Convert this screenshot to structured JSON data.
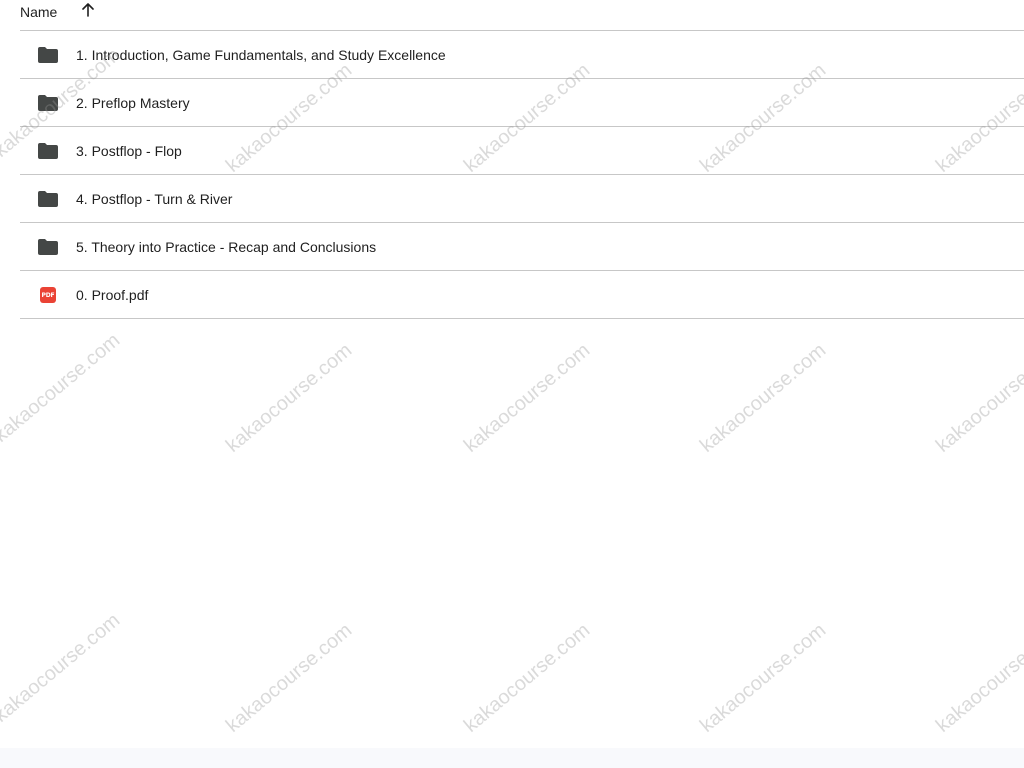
{
  "header": {
    "name_label": "Name",
    "sort_icon": "arrow-up-icon"
  },
  "files": [
    {
      "name": "1. Introduction, Game Fundamentals, and Study Excellence",
      "type": "folder",
      "icon": "folder-icon"
    },
    {
      "name": "2. Preflop Mastery",
      "type": "folder",
      "icon": "folder-icon"
    },
    {
      "name": "3. Postflop - Flop",
      "type": "folder",
      "icon": "folder-icon"
    },
    {
      "name": "4. Postflop - Turn & River",
      "type": "folder",
      "icon": "folder-icon"
    },
    {
      "name": "5. Theory into Practice - Recap and Conclusions",
      "type": "folder",
      "icon": "folder-icon"
    },
    {
      "name": "0. Proof.pdf",
      "type": "pdf",
      "icon": "pdf-icon",
      "badge": "PDF"
    }
  ],
  "watermark": "kakaocourse.com",
  "colors": {
    "folder": "#444746",
    "pdf": "#ea4335",
    "divider": "#c7c7c7",
    "text": "#1f1f1f"
  }
}
